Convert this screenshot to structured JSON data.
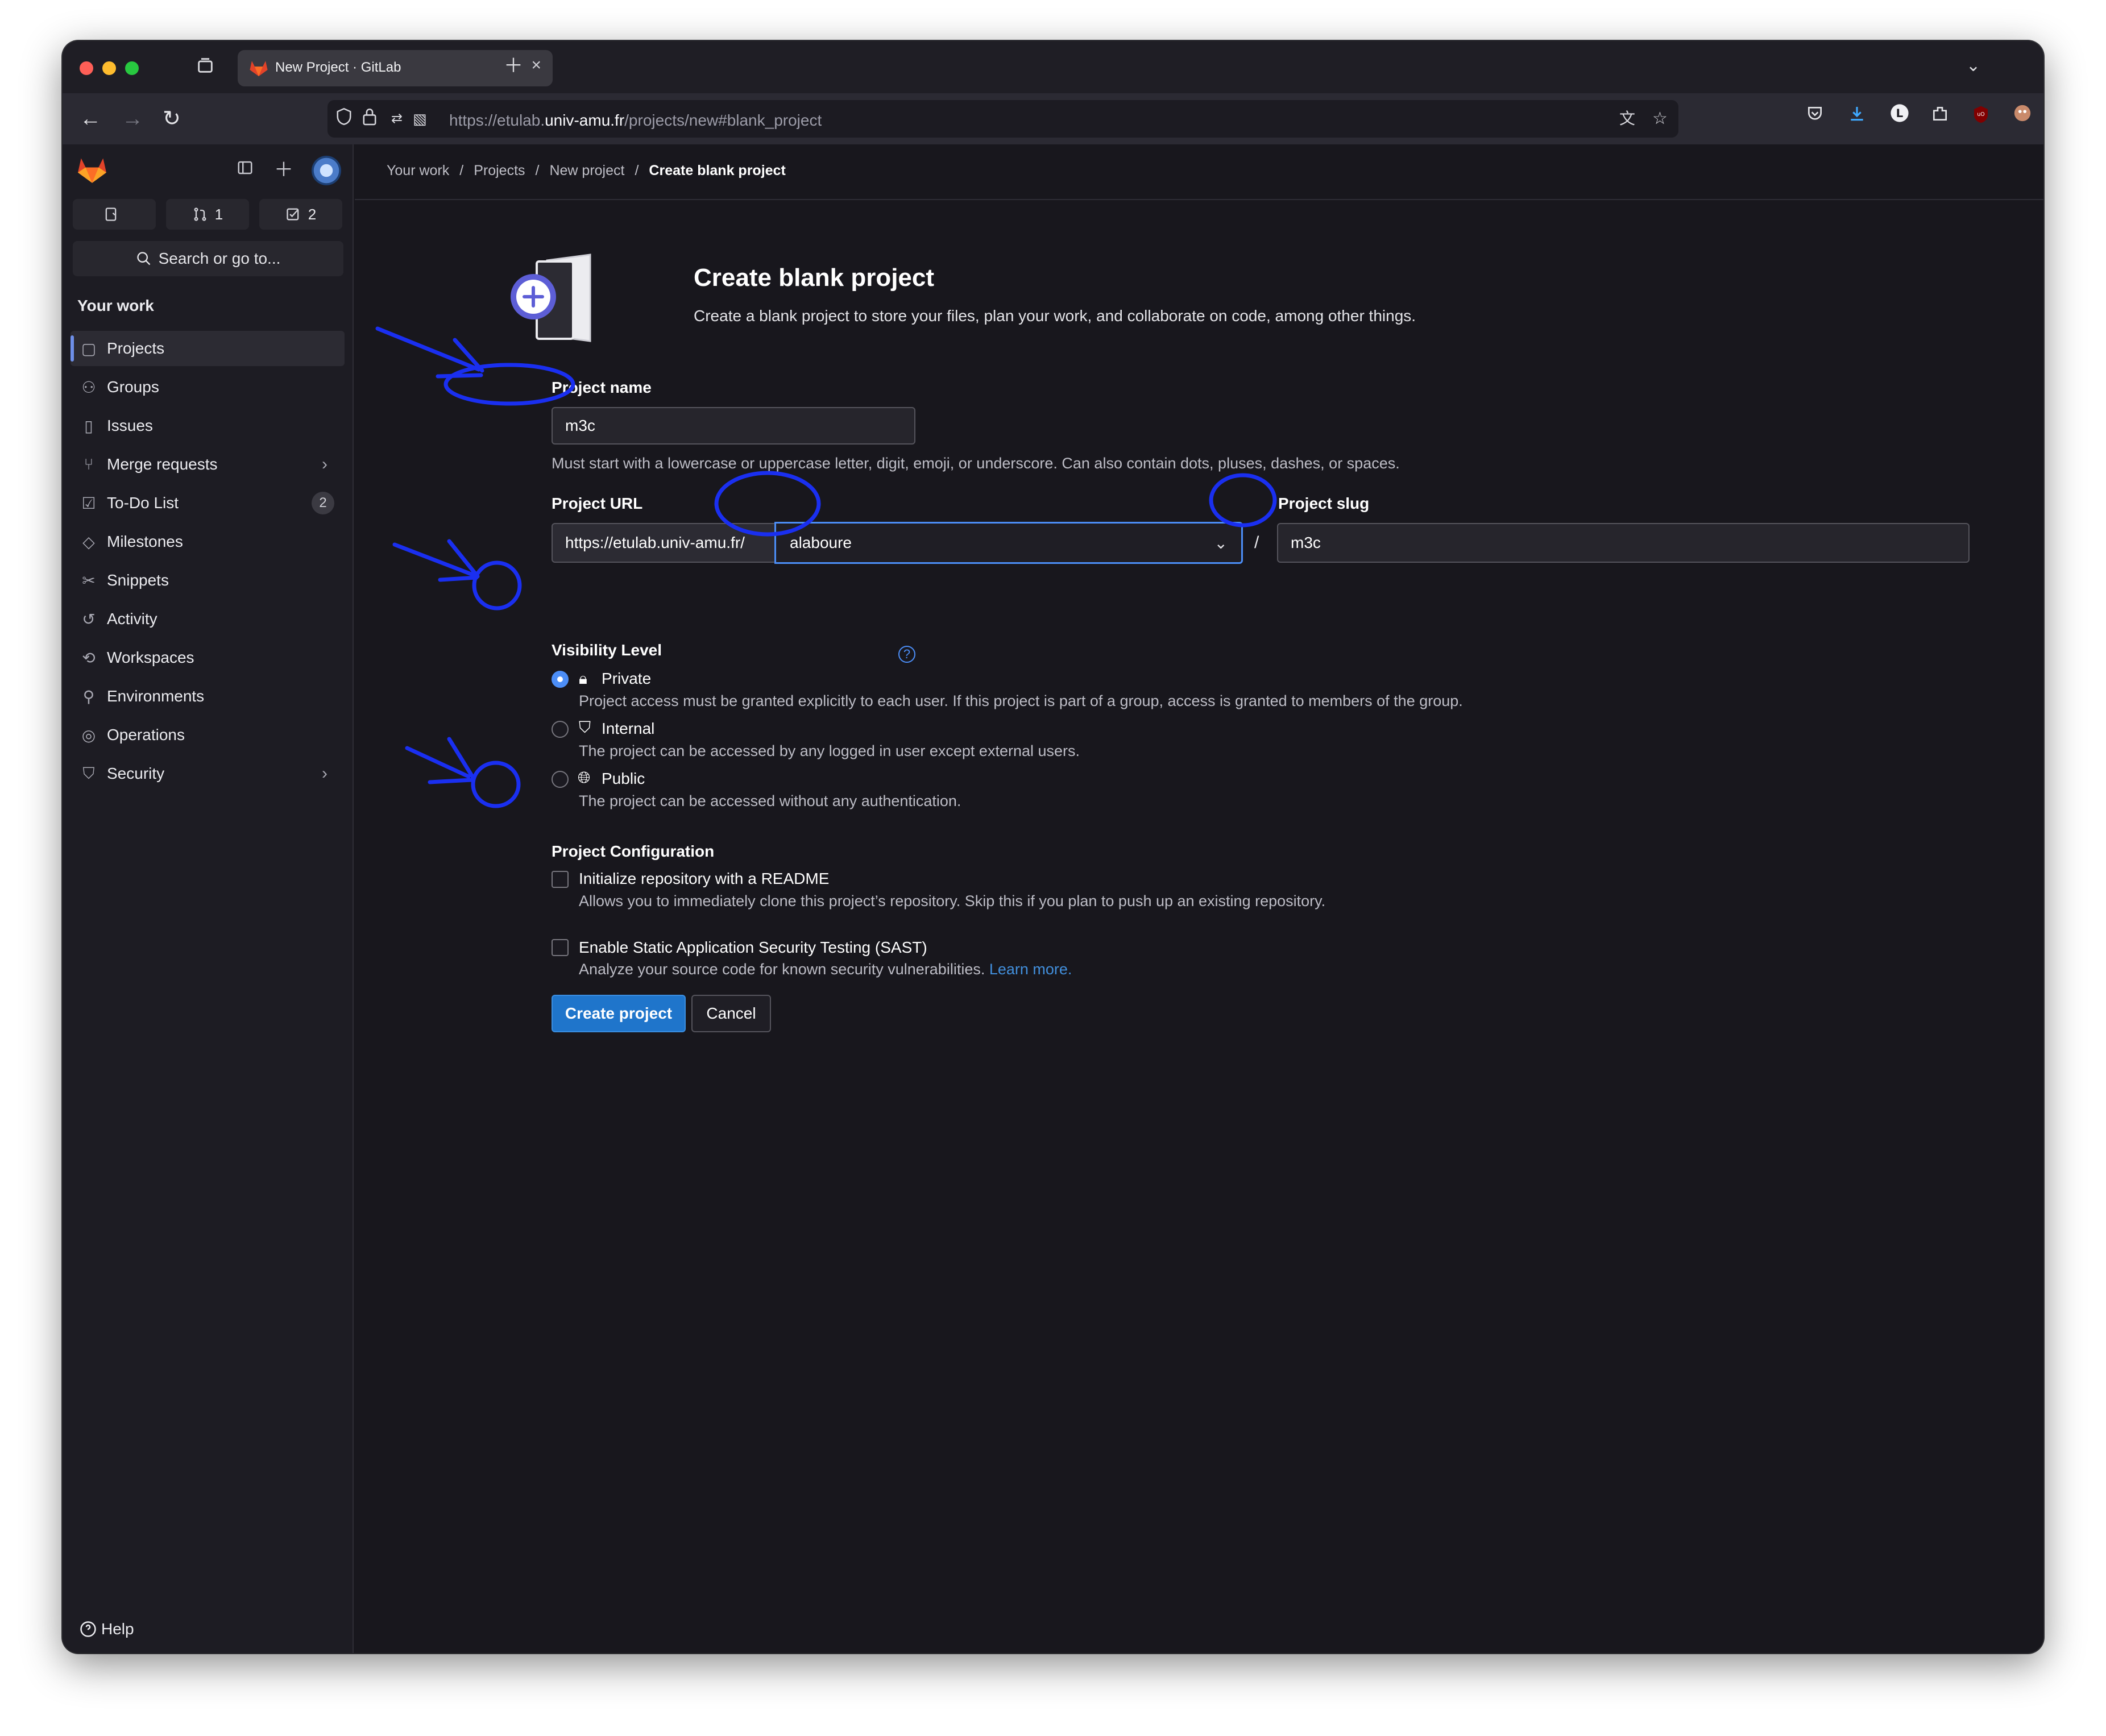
{
  "browser": {
    "tab_title": "New Project · GitLab",
    "url_prefix": "https://etulab.",
    "url_domain": "univ-amu.fr",
    "url_path": "/projects/new#blank_project"
  },
  "sidebar": {
    "counters": [
      {
        "icon": "issues-icon",
        "count": ""
      },
      {
        "icon": "merge-request-icon",
        "count": "1"
      },
      {
        "icon": "todo-icon",
        "count": "2"
      }
    ],
    "search_label": "Search or go to...",
    "section_title": "Your work",
    "items": [
      {
        "label": "Projects",
        "icon": "project-icon",
        "active": true
      },
      {
        "label": "Groups",
        "icon": "group-icon"
      },
      {
        "label": "Issues",
        "icon": "issues-icon"
      },
      {
        "label": "Merge requests",
        "icon": "merge-request-icon",
        "chevron": true
      },
      {
        "label": "To-Do List",
        "icon": "todo-icon",
        "badge": "2"
      },
      {
        "label": "Milestones",
        "icon": "milestone-icon"
      },
      {
        "label": "Snippets",
        "icon": "snippet-icon"
      },
      {
        "label": "Activity",
        "icon": "history-icon"
      },
      {
        "label": "Workspaces",
        "icon": "workspace-icon"
      },
      {
        "label": "Environments",
        "icon": "environment-icon"
      },
      {
        "label": "Operations",
        "icon": "operations-icon"
      },
      {
        "label": "Security",
        "icon": "shield-icon",
        "chevron": true
      }
    ],
    "help_label": "Help"
  },
  "breadcrumb": [
    "Your work",
    "Projects",
    "New project",
    "Create blank project"
  ],
  "hero": {
    "title": "Create blank project",
    "description": "Create a blank project to store your files, plan your work, and collaborate on code, among other things."
  },
  "form": {
    "project_name_label": "Project name",
    "project_name_value": "m3c",
    "project_name_hint": "Must start with a lowercase or uppercase letter, digit, emoji, or underscore. Can also contain dots, pluses, dashes, or spaces.",
    "project_url_label": "Project URL",
    "project_url_prefix": "https://etulab.univ-amu.fr/",
    "namespace_value": "alaboure",
    "slash": "/",
    "project_slug_label": "Project slug",
    "project_slug_value": "m3c",
    "visibility_label": "Visibility Level",
    "visibility_options": [
      {
        "label": "Private",
        "description": "Project access must be granted explicitly to each user. If this project is part of a group, access is granted to members of the group.",
        "selected": true
      },
      {
        "label": "Internal",
        "description": "The project can be accessed by any logged in user except external users.",
        "selected": false
      },
      {
        "label": "Public",
        "description": "The project can be accessed without any authentication.",
        "selected": false
      }
    ],
    "config_label": "Project Configuration",
    "readme_label": "Initialize repository with a README",
    "readme_hint": "Allows you to immediately clone this project’s repository. Skip this if you plan to push up an existing repository.",
    "sast_label": "Enable Static Application Security Testing (SAST)",
    "sast_hint": "Analyze your source code for known security vulnerabilities.",
    "sast_link": "Learn more.",
    "create_button": "Create project",
    "cancel_button": "Cancel"
  },
  "colors": {
    "accent": "#1f75cb",
    "annotation": "#1a2ff0",
    "background": "#18171d"
  }
}
